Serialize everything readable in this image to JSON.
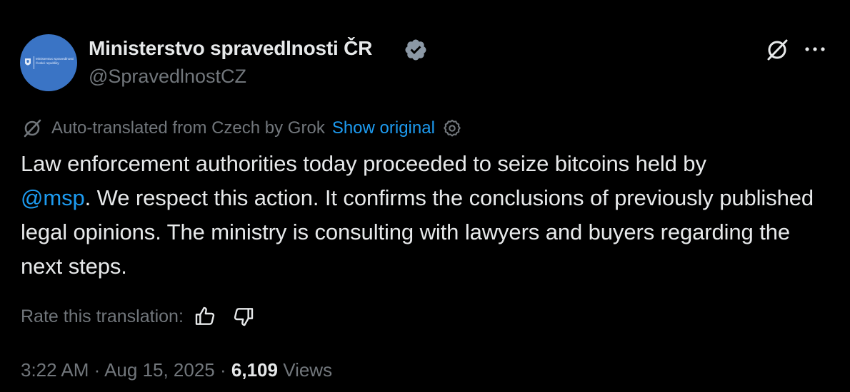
{
  "author": {
    "display_name": "Ministerstvo spravedlnosti ČR",
    "handle": "@SpravedlnostCZ",
    "verified": true,
    "avatar": {
      "background": "#3a74c5",
      "org_line_1": "Ministerstvo spravedlnosti",
      "org_line_2": "České republiky"
    }
  },
  "header_actions": {
    "grok_icon": "grok-icon",
    "more_icon": "more-horizontal-icon"
  },
  "translation": {
    "icon": "grok-icon",
    "notice": "Auto-translated from Czech by Grok",
    "show_original": "Show original",
    "settings_icon": "gear-icon"
  },
  "body": {
    "text_before_mention": "Law enforcement authorities today proceeded to seize bitcoins held by ",
    "mention": "@msp",
    "text_after_mention": ". We respect this action. It confirms the conclusions of previously published legal opinions. The ministry is consulting with lawyers and buyers regarding the next steps."
  },
  "rating": {
    "label": "Rate this translation:",
    "thumbs_up_icon": "thumbs-up-icon",
    "thumbs_down_icon": "thumbs-down-icon"
  },
  "meta": {
    "time": "3:22 AM",
    "separator": " · ",
    "date": "Aug 15, 2025",
    "views_count": "6,109",
    "views_label": "Views"
  },
  "colors": {
    "background": "#000000",
    "text_primary": "#e7e9ea",
    "text_secondary": "#71767b",
    "accent": "#1d9bf0"
  }
}
